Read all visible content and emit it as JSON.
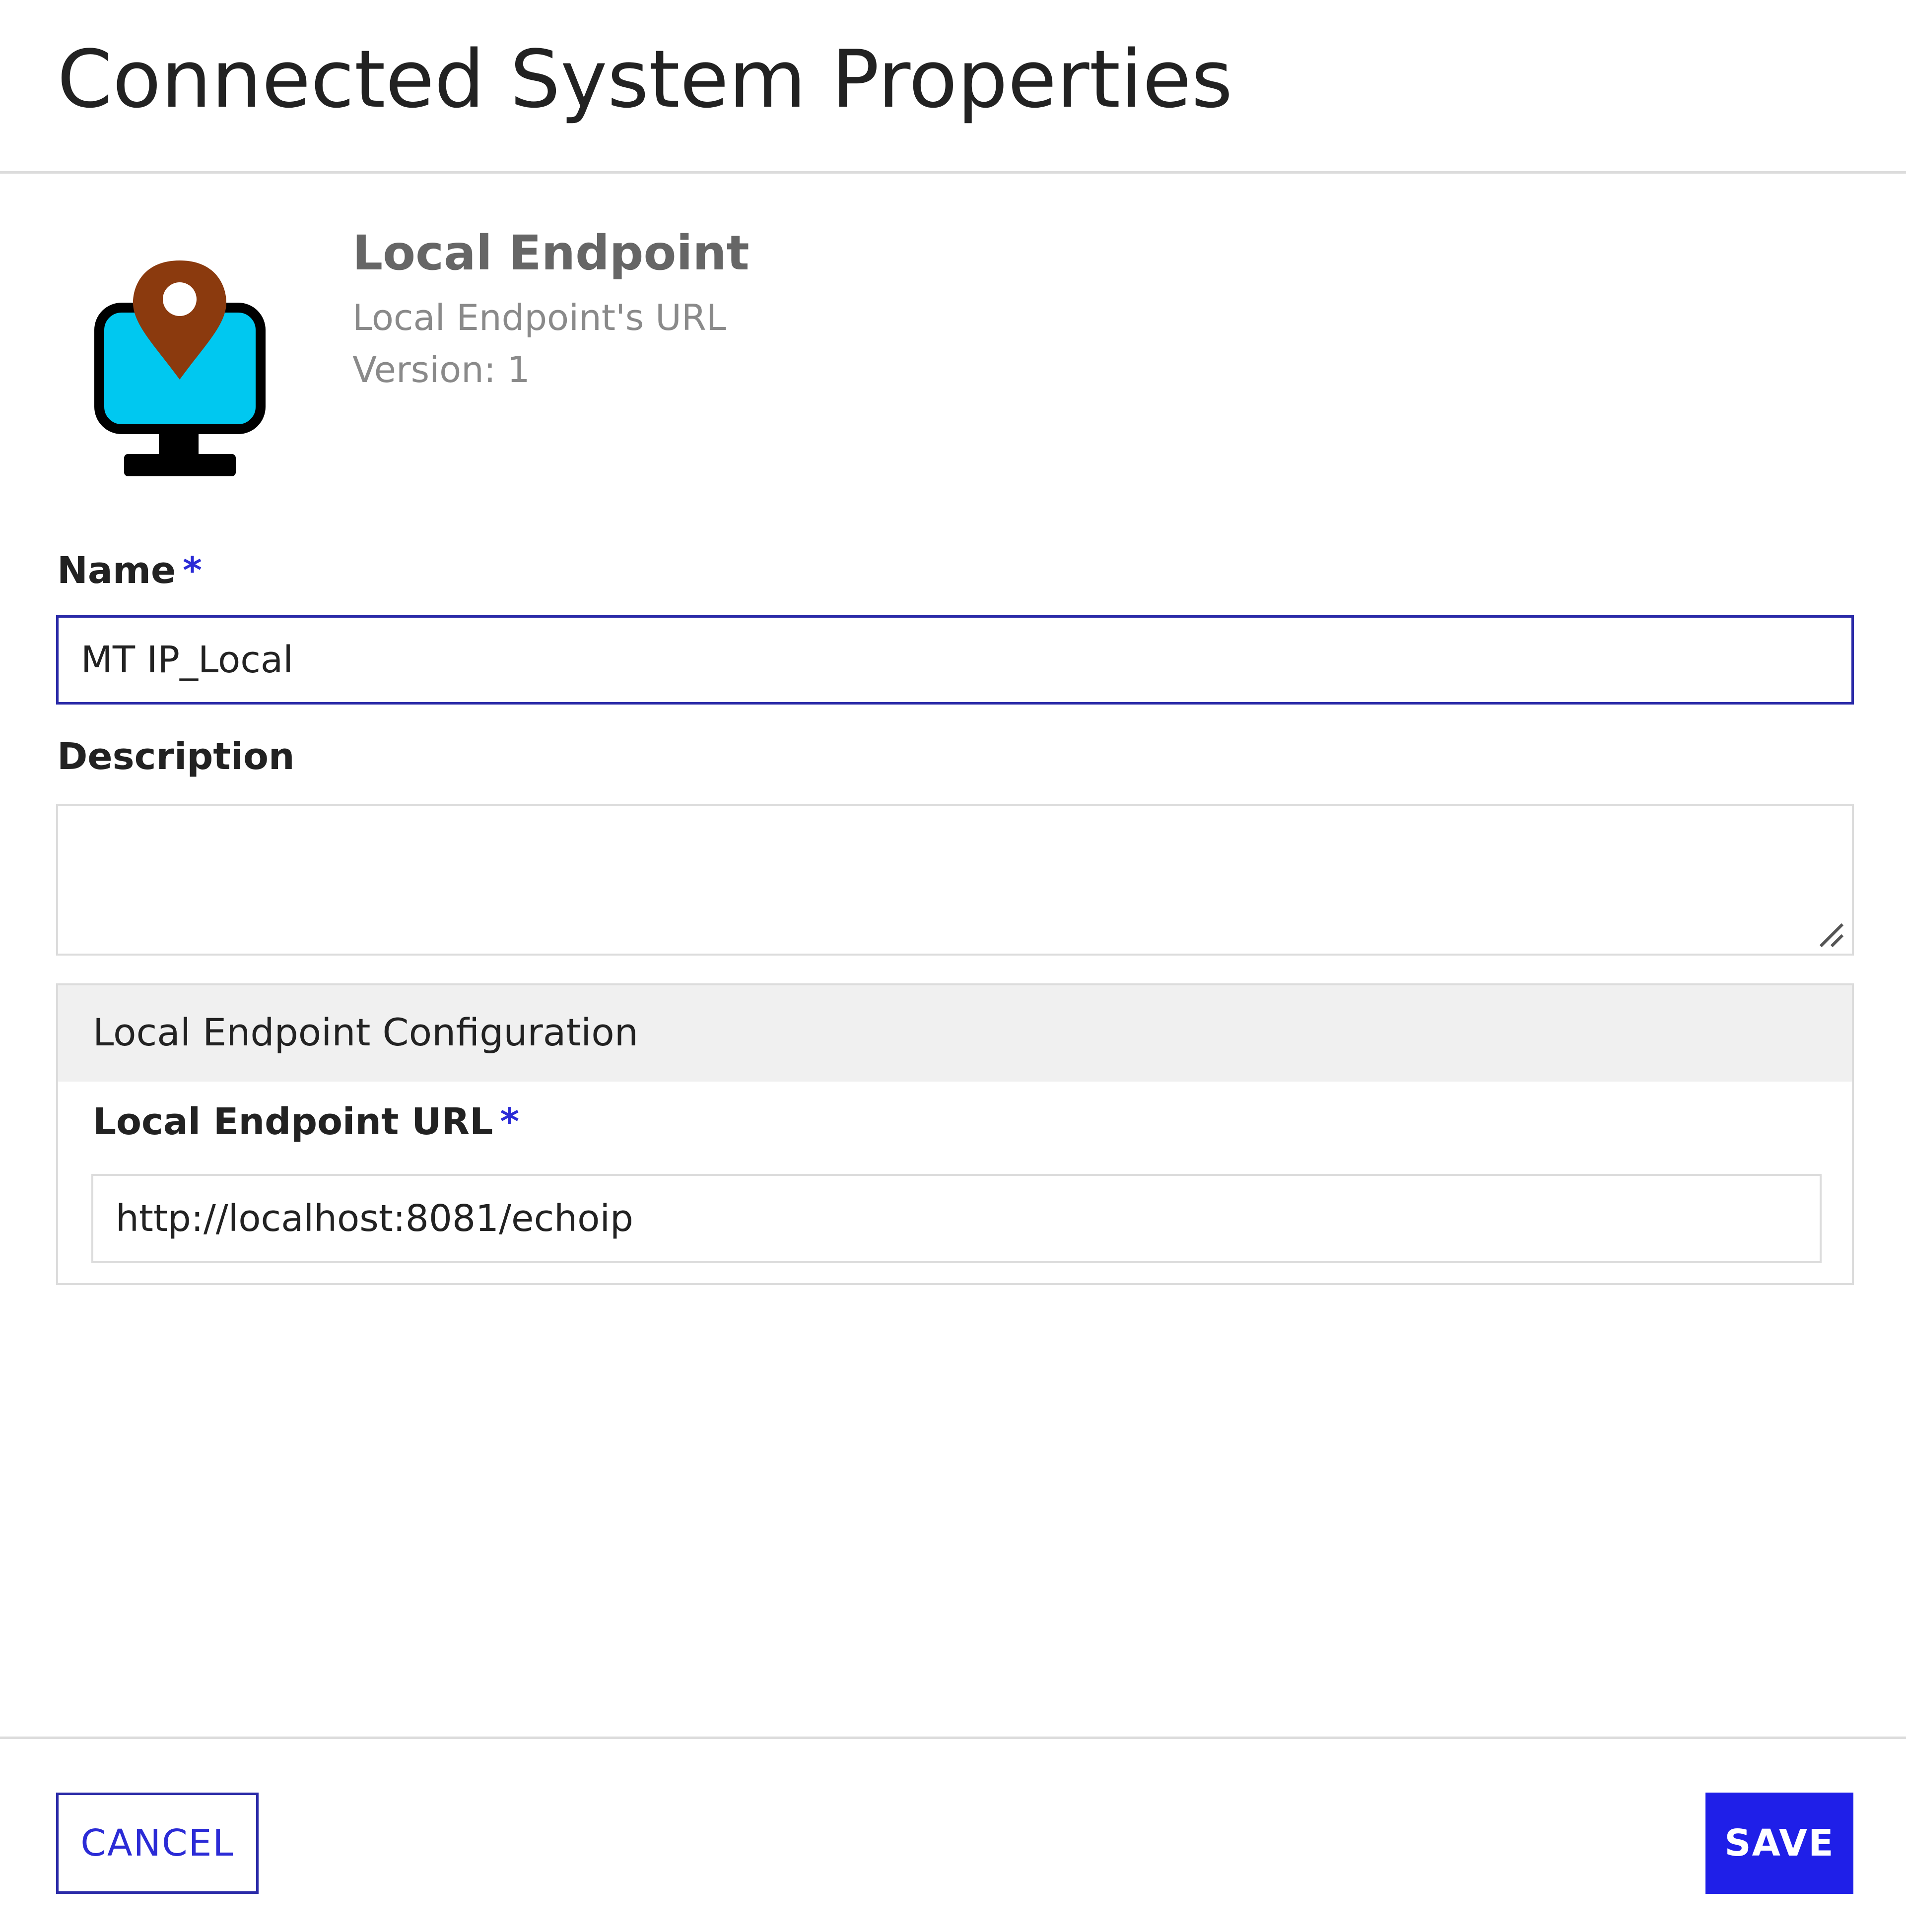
{
  "dialog": {
    "title": "Connected System Properties"
  },
  "system": {
    "name": "Local Endpoint",
    "description": "Local Endpoint's URL",
    "version": "Version: 1",
    "icon": "monitor-location-pin-icon"
  },
  "form": {
    "name_label": "Name",
    "name_value": "MT IP_Local",
    "description_label": "Description",
    "description_value": "",
    "required_marker": "*"
  },
  "config": {
    "section_title": "Local Endpoint Configuration",
    "url_label": "Local Endpoint URL",
    "url_value": "http://localhost:8081/echoip"
  },
  "footer": {
    "cancel_label": "CANCEL",
    "save_label": "SAVE"
  },
  "colors": {
    "accent": "#1f1fe8",
    "pin": "#8b3a0e",
    "screen": "#00c8f0"
  }
}
